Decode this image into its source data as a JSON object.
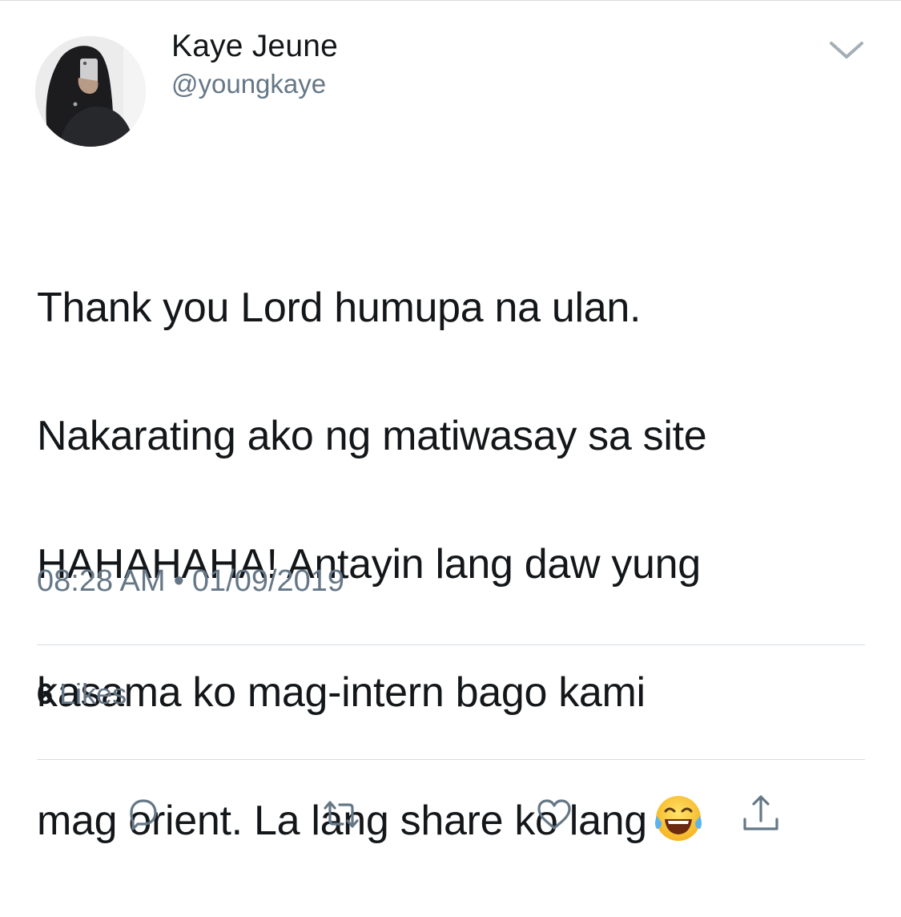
{
  "user": {
    "display_name": "Kaye Jeune",
    "handle": "@youngkaye",
    "avatar_alt": "profile photo"
  },
  "tweet": {
    "lines": [
      "Thank you Lord humupa na ulan.",
      "Nakarating ako ng matiwasay sa site",
      "HAHAHAHA! Antayin lang daw yung",
      "kasama ko mag-intern bago kami",
      "mag orient. La lang share ko lang"
    ],
    "emoji": "face-with-tears-of-joy",
    "time": "08:28 AM",
    "separator": "•",
    "date": "01/09/2019"
  },
  "stats": {
    "likes_count": "6",
    "likes_label": "Likes"
  },
  "actions": {
    "reply_icon": "reply-icon",
    "retweet_icon": "retweet-icon",
    "like_icon": "heart-icon",
    "share_icon": "share-icon"
  },
  "colors": {
    "text_primary": "#14171a",
    "text_secondary": "#657786",
    "divider": "#d8dde1"
  }
}
